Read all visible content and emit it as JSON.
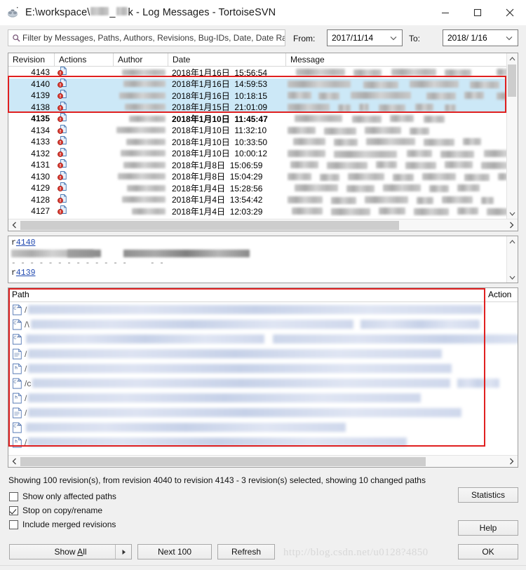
{
  "window": {
    "title": "E:\\workspace\\",
    "title_suffix": "k - Log Messages - TortoiseSVN",
    "icon": "tortoisesvn-icon",
    "minimize": "−",
    "maximize": "□",
    "close": "✕"
  },
  "filter": {
    "icon": "search-icon",
    "placeholder": "Filter by Messages, Paths, Authors, Revisions, Bug-IDs, Date, Date Ran",
    "value": ""
  },
  "daterange": {
    "from_label": "From:",
    "from_value": "2017/11/14",
    "to_label": "To:",
    "to_value": "2018/ 1/16",
    "chevron": "chevron-down-icon"
  },
  "revision_list": {
    "columns": [
      "Revision",
      "Actions",
      "Author",
      "Date",
      "Message"
    ],
    "rows": [
      {
        "revision": "4143",
        "date": "2018年1月16日  15:56:54",
        "selected": false,
        "bold": false
      },
      {
        "revision": "4140",
        "date": "2018年1月16日  14:59:53",
        "selected": true,
        "bold": false
      },
      {
        "revision": "4139",
        "date": "2018年1月16日  10:18:15",
        "selected": true,
        "bold": false
      },
      {
        "revision": "4138",
        "date": "2018年1月15日  21:01:09",
        "selected": true,
        "bold": false
      },
      {
        "revision": "4135",
        "date": "2018年1月10日  11:45:47",
        "selected": false,
        "bold": true
      },
      {
        "revision": "4134",
        "date": "2018年1月10日  11:32:10",
        "selected": false,
        "bold": false
      },
      {
        "revision": "4133",
        "date": "2018年1月10日  10:33:50",
        "selected": false,
        "bold": false
      },
      {
        "revision": "4132",
        "date": "2018年1月10日  10:00:12",
        "selected": false,
        "bold": false
      },
      {
        "revision": "4131",
        "date": "2018年1月8日  15:06:59",
        "selected": false,
        "bold": false
      },
      {
        "revision": "4130",
        "date": "2018年1月8日  15:04:29",
        "selected": false,
        "bold": false
      },
      {
        "revision": "4129",
        "date": "2018年1月4日  15:28:56",
        "selected": false,
        "bold": false
      },
      {
        "revision": "4128",
        "date": "2018年1月4日  13:54:42",
        "selected": false,
        "bold": false
      },
      {
        "revision": "4127",
        "date": "2018年1月4日  12:03:29",
        "selected": false,
        "bold": false
      }
    ],
    "action_icon": "modified-file-icon",
    "selection_highlight_color": "#e02020",
    "selected_row_color": "#cce8f7"
  },
  "message_pane": {
    "entries": [
      {
        "prefix": "r",
        "rev": "4140"
      },
      {
        "prefix": "r",
        "rev": "4139"
      }
    ],
    "separator": "- - - - - - - - - - - - -     - -",
    "link_color": "#2149b0"
  },
  "path_list": {
    "columns": [
      "Path",
      "Action"
    ],
    "rows": [
      {
        "icon": "cpp-file-icon",
        "path": "/"
      },
      {
        "icon": "cpp-file-icon",
        "path": "/\\"
      },
      {
        "icon": "cpp-file-icon",
        "path": ""
      },
      {
        "icon": "text-file-icon",
        "path": "/"
      },
      {
        "icon": "header-file-icon",
        "path": "/"
      },
      {
        "icon": "cpp-file-icon",
        "path": "/c"
      },
      {
        "icon": "header-file-icon",
        "path": "/"
      },
      {
        "icon": "text-file-icon",
        "path": "/"
      },
      {
        "icon": "cpp-file-icon",
        "path": ""
      },
      {
        "icon": "header-file-icon",
        "path": "/"
      }
    ],
    "highlight_color": "#e02020"
  },
  "status": {
    "text": "Showing 100 revision(s), from revision 4040 to revision 4143 - 3 revision(s) selected, showing 10 changed paths"
  },
  "options": [
    {
      "label": "Show only affected paths",
      "checked": false
    },
    {
      "label": "Stop on copy/rename",
      "checked": true
    },
    {
      "label": "Include merged revisions",
      "checked": false
    }
  ],
  "buttons": {
    "show_all_prefix": "Show ",
    "show_all_accel": "A",
    "show_all_suffix": "ll",
    "show_all_arrow": "▶",
    "next_100": "Next 100",
    "refresh": "Refresh",
    "statistics": "Statistics",
    "help": "Help",
    "ok": "OK"
  },
  "watermark": {
    "text": "http://blog.csdn.net/u0128?4850"
  }
}
